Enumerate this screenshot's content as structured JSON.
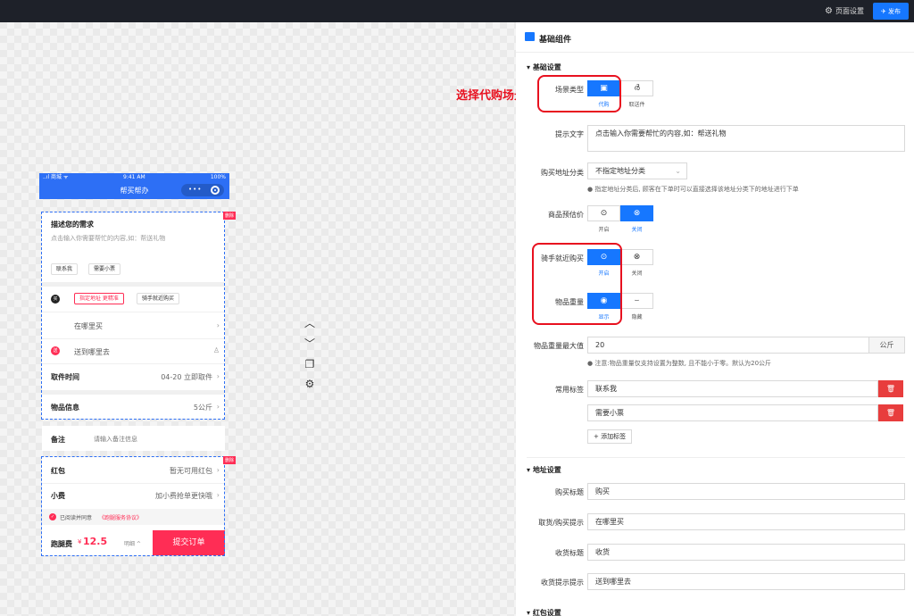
{
  "topbar": {
    "page_settings": "页面设置",
    "publish": "✈ 发布"
  },
  "phone": {
    "status": {
      "carrier": "..ıl 商城 ᯤ",
      "time": "9:41 AM",
      "battery": "100%"
    },
    "nav_title": "帮买帮办",
    "delete_badge": "删除",
    "need": {
      "title": "描述您的需求",
      "placeholder": "点击输入你需要帮忙的内容,如：帮送礼物",
      "tags": [
        "联系我",
        "需要小票"
      ]
    },
    "buy": {
      "icon": "买",
      "opt1": "指定地址 更精准",
      "opt2": "骑手就近购买",
      "where": "在哪里买"
    },
    "recv": {
      "icon": "送",
      "where": "送到哪里去"
    },
    "pickup": {
      "label": "取件时间",
      "value": "04-20 立即取件"
    },
    "goods": {
      "label": "物品信息",
      "value": "5公斤"
    },
    "remark": {
      "label": "备注",
      "placeholder": "请输入备注信息"
    },
    "redpack": {
      "label": "红包",
      "value": "暂无可用红包"
    },
    "tip": {
      "label": "小费",
      "value": "加小费抢单更快哦"
    },
    "agree": {
      "text": "已阅读并同意",
      "link": "《跑腿服务协议》"
    },
    "fee": {
      "label": "跑腿费",
      "currency": "¥",
      "amount": "12.5",
      "detail": "明细 ^",
      "submit": "提交订单"
    }
  },
  "panel": {
    "title": "基础组件",
    "basic_group": "基础设置",
    "scene": {
      "label": "场景类型",
      "opt1": "代购",
      "opt2": "取送件"
    },
    "annotation": "选择代购场景",
    "hint_text": {
      "label": "提示文字",
      "value": "点击输入你需要帮忙的内容,如：帮送礼物"
    },
    "addr_cat": {
      "label": "购买地址分类",
      "value": "不指定地址分类",
      "hint": "指定地址分类后, 顾客在下单时可以直接选择该地址分类下的地址进行下单"
    },
    "price": {
      "label": "商品预估价",
      "opt1": "开启",
      "opt2": "关闭"
    },
    "rider": {
      "label": "骑手就近购买",
      "opt1": "开启",
      "opt2": "关闭"
    },
    "weight": {
      "label": "物品重量",
      "opt1": "显示",
      "opt2": "隐藏"
    },
    "max_weight": {
      "label": "物品重量最大值",
      "value": "20",
      "unit": "公斤",
      "hint": "注意:物品重量仅支持设置为整数, 且不能小于零。默认为20公斤"
    },
    "tags": {
      "label": "常用标签",
      "items": [
        "联系我",
        "需要小票"
      ],
      "add": "+ 添加标签"
    },
    "addr_group": "地址设置",
    "buy_title": {
      "label": "购买标题",
      "value": "购买"
    },
    "pick_hint": {
      "label": "取货/购买提示",
      "value": "在哪里买"
    },
    "recv_title": {
      "label": "收货标题",
      "value": "收货"
    },
    "recv_hint": {
      "label": "收货提示提示",
      "value": "送到哪里去"
    },
    "red_group": "红包设置"
  },
  "colors": {
    "accent": "#1677ff",
    "highlight": "#e8111f",
    "submit": "#ff2d55"
  }
}
